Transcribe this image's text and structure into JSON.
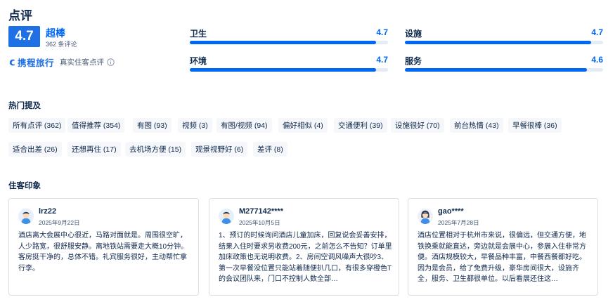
{
  "title": "点评",
  "summary": {
    "score": "4.7",
    "score_word": "超棒",
    "review_count": "362 条评论",
    "brand_name": "携程旅行",
    "brand_text": "真实住客点评"
  },
  "metrics": [
    {
      "label": "卫生",
      "value": "4.7",
      "fraction": 0.94
    },
    {
      "label": "设施",
      "value": "4.7",
      "fraction": 0.94
    },
    {
      "label": "环境",
      "value": "4.7",
      "fraction": 0.94
    },
    {
      "label": "服务",
      "value": "4.6",
      "fraction": 0.92
    }
  ],
  "hot_title": "热门提及",
  "tags": [
    "所有点评 (362)",
    "值得推荐 (354)",
    "有图 (93)",
    "视频 (3)",
    "有图/视频 (94)",
    "偏好相似 (4)",
    "交通便利 (39)",
    "设施很好 (70)",
    "前台热情 (43)",
    "早餐很棒 (36)",
    "适合出差 (26)",
    "还想再住 (17)",
    "去机场方便 (15)",
    "观景视野好 (6)",
    "差评 (8)"
  ],
  "impressions_title": "住客印象",
  "reviews": [
    {
      "user": "lrz22",
      "date": "2025年9月22日",
      "avatar": "male-avatar-icon",
      "text": "酒店离大会展中心很近，马路对面就是。周围很空旷，人少路宽，很舒服安静。离地铁站需要走大概10分钟。客房挺干净的，总体不错。礼宾服务很好，主动帮忙拿行李。"
    },
    {
      "user": "M277142****",
      "date": "2025年10月5日",
      "avatar": "male-avatar-icon",
      "text": "1、预订的时候询问酒店儿童加床，回复说会妥善安排，结果入住时要求另收费200元，之前怎么不告知？订单里加床政策也无说明收费。2、房间空调风噪声大很吵3、第一次早餐没位置只能站着随便扒几口，有很多穿橙色T的会议团队来，门口不控制人数全部…"
    },
    {
      "user": "gao****",
      "date": "2025年7月28日",
      "avatar": "female-avatar-icon",
      "text": "酒店位置相对于杭州市来说，很偏远，但交通方便，地铁换乘就能直达，旁边就是会展中心，参展入住非常方便。酒店规模较大，早餐品种丰富，中餐西餐都好吃。因为是会员，给了免费升级，豪华房间很大，设施齐全，服务、卫生都很单位。以后看展还住这…"
    }
  ],
  "colors": {
    "accent": "#0066f6",
    "score_bg": "#1f6fe5",
    "track": "#e4ebf4",
    "tag_bg": "#f5f7fa"
  }
}
